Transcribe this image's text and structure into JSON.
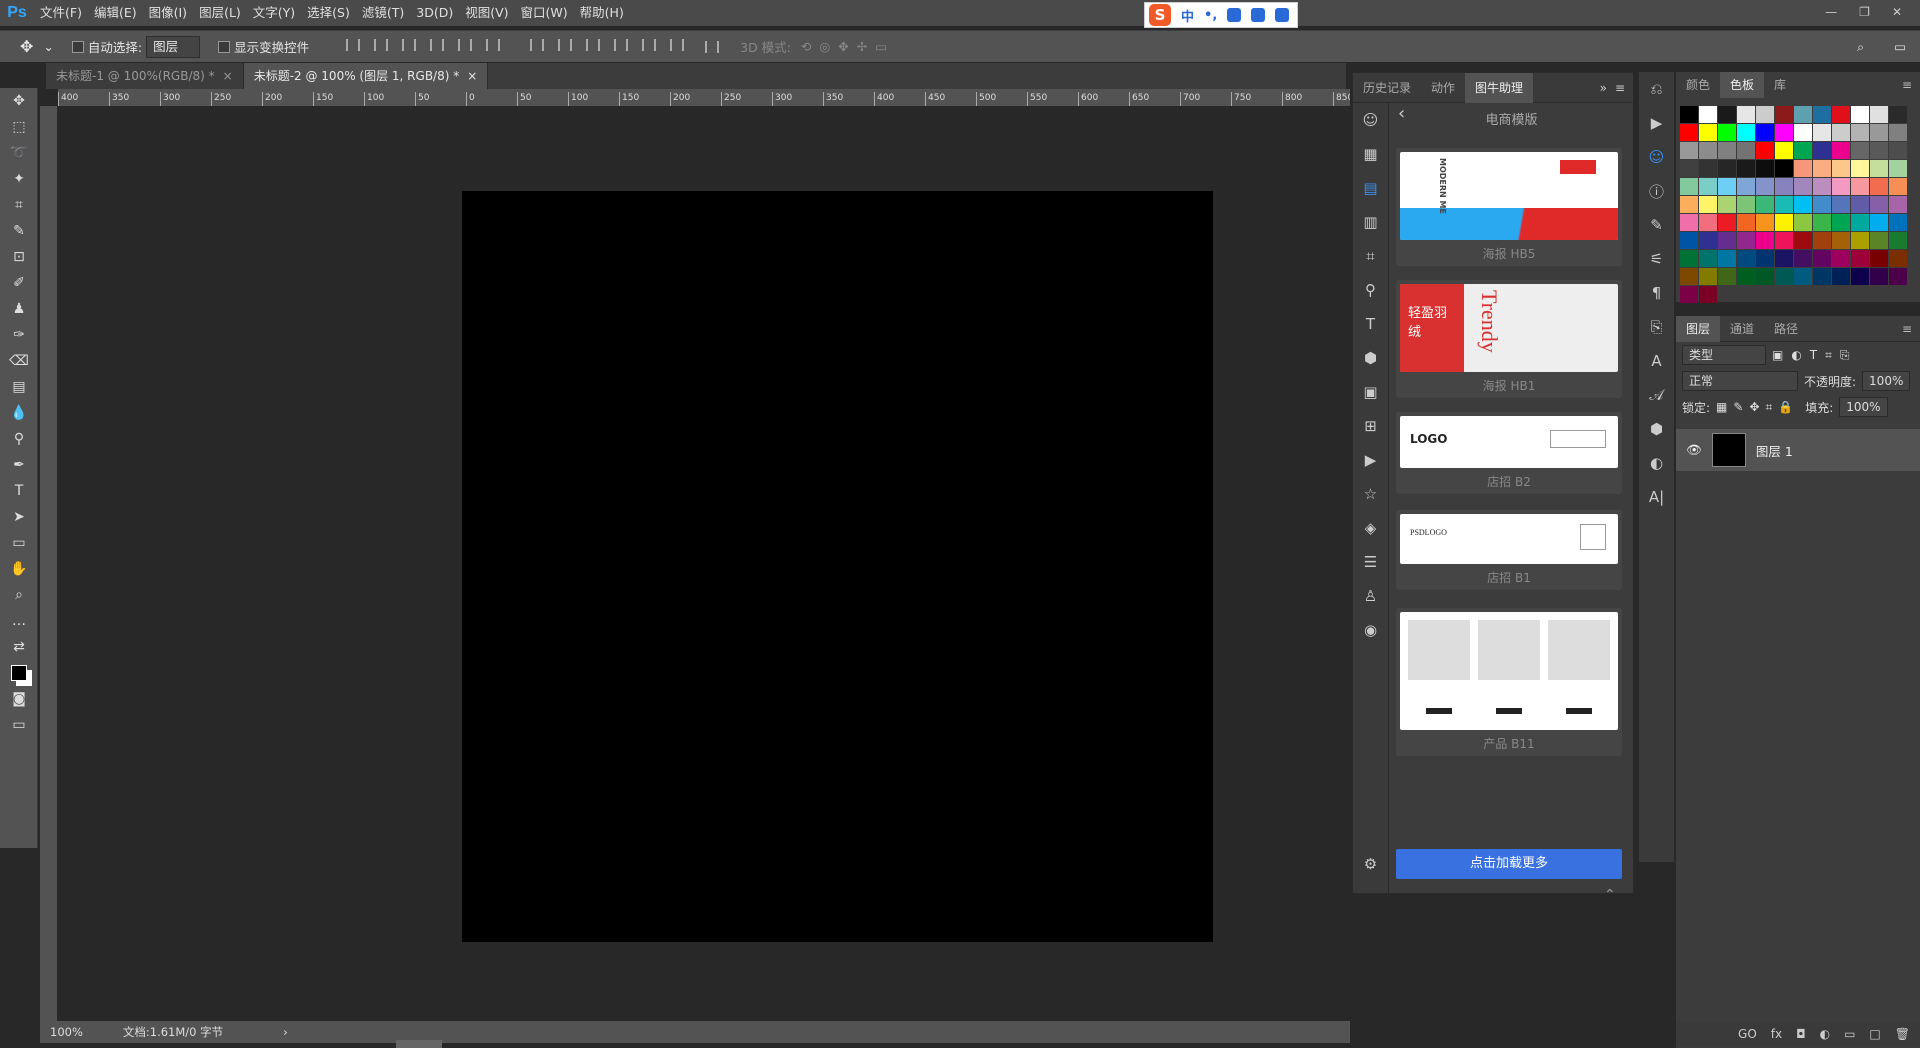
{
  "app": {
    "logo": "Ps"
  },
  "menu": [
    "文件(F)",
    "编辑(E)",
    "图像(I)",
    "图层(L)",
    "文字(Y)",
    "选择(S)",
    "滤镜(T)",
    "3D(D)",
    "视图(V)",
    "窗口(W)",
    "帮助(H)"
  ],
  "ime": {
    "brand": "S",
    "mode": "中"
  },
  "window_controls": [
    "—",
    "❐",
    "✕"
  ],
  "options": {
    "auto_select_label": "自动选择:",
    "auto_select_value": "图层",
    "show_transform_label": "显示变换控件",
    "mode3d_label": "3D 模式:"
  },
  "tabs": [
    {
      "label": "未标题-1 @ 100%(RGB/8) *",
      "active": false
    },
    {
      "label": "未标题-2 @ 100% (图层 1, RGB/8) *",
      "active": true
    }
  ],
  "ruler_h": [
    "400",
    "350",
    "300",
    "250",
    "200",
    "150",
    "100",
    "50",
    "0",
    "50",
    "100",
    "150",
    "200",
    "250",
    "300",
    "350",
    "400",
    "450",
    "500",
    "550",
    "600",
    "650",
    "700",
    "750",
    "800",
    "850"
  ],
  "status": {
    "zoom": "100%",
    "doc": "文档:1.61M/0 字节",
    "arrow": "›"
  },
  "panel": {
    "tabs": [
      "历史记录",
      "动作",
      "图牛助理"
    ],
    "title": "电商模版",
    "templates": [
      {
        "caption": "海报 HB5"
      },
      {
        "caption": "海报 HB1"
      },
      {
        "caption": "店招 B2",
        "logo": "LOGO"
      },
      {
        "caption": "店招 B1",
        "logo": "PSDLOGO"
      },
      {
        "caption": "产品 B11"
      }
    ],
    "load_more": "点击加载更多",
    "hb5_text": "MODERN ME",
    "hb1_text_cn": "轻盈羽绒",
    "hb1_text_en": "Trendy"
  },
  "swatches": {
    "tabs": [
      "颜色",
      "色板",
      "库"
    ],
    "colors": [
      "#000000",
      "#ffffff",
      "#1a1a1a",
      "#e6e6e6",
      "#cccccc",
      "#8c1a1a",
      "#5fa0b0",
      "#1e6ea0",
      "#e0101a",
      "#ffffff",
      "#e0e0e0",
      "#2a2a2a",
      "#ff0000",
      "#ffff00",
      "#00ff00",
      "#00ffff",
      "#0000ff",
      "#ff00ff",
      "#ffffff",
      "#e6e6e6",
      "#cccccc",
      "#b3b3b3",
      "#999999",
      "#808080",
      "#999999",
      "#8c8c8c",
      "#808080",
      "#737373",
      "#ff0000",
      "#ffff00",
      "#00a651",
      "#2e3192",
      "#ec008c",
      "#666666",
      "#595959",
      "#4d4d4d",
      "#404040",
      "#333333",
      "#262626",
      "#1a1a1a",
      "#0d0d0d",
      "#000000",
      "#f7977a",
      "#f9ad81",
      "#fdc68a",
      "#fff79a",
      "#c4df9b",
      "#a3d39c",
      "#82ca9d",
      "#7bcdc8",
      "#6ecff6",
      "#7ea7d8",
      "#8493ca",
      "#8882be",
      "#a187be",
      "#bc8dbf",
      "#f49ac2",
      "#f6989d",
      "#f26c4f",
      "#f68e55",
      "#fbaf5c",
      "#fff467",
      "#acd372",
      "#7cc576",
      "#3bb878",
      "#1abbb4",
      "#00bff3",
      "#438ccb",
      "#5574b9",
      "#605ca8",
      "#8560a8",
      "#a864a8",
      "#f06ea9",
      "#f26d7d",
      "#ed1c24",
      "#f26522",
      "#f7941d",
      "#fff200",
      "#8dc73f",
      "#39b54a",
      "#00a651",
      "#00a99d",
      "#00aeef",
      "#0072bc",
      "#0054a6",
      "#2e3192",
      "#662d91",
      "#92278f",
      "#ec008c",
      "#ed145b",
      "#9e0b0f",
      "#a0410d",
      "#a3620a",
      "#aba000",
      "#598527",
      "#197b30",
      "#007236",
      "#00746b",
      "#0076a3",
      "#004a80",
      "#003471",
      "#1b1464",
      "#440e62",
      "#630460",
      "#9e005d",
      "#9e0039",
      "#790000",
      "#7b2e00",
      "#7d4900",
      "#827b00",
      "#406618",
      "#005e20",
      "#005826",
      "#005952",
      "#005b7f",
      "#003663",
      "#002157",
      "#0d004c",
      "#32004b",
      "#4b0049",
      "#7b0046",
      "#7a0026"
    ]
  },
  "layers": {
    "tabs": [
      "图层",
      "通道",
      "路径"
    ],
    "filter": "类型",
    "blend": "正常",
    "opacity_label": "不透明度:",
    "opacity": "100%",
    "lock_label": "锁定:",
    "fill_label": "填充:",
    "fill": "100%",
    "layer_name": "图层 1",
    "footer": [
      "GO",
      "fx",
      "◘",
      "◐",
      "▭",
      "□",
      "🗑"
    ]
  }
}
